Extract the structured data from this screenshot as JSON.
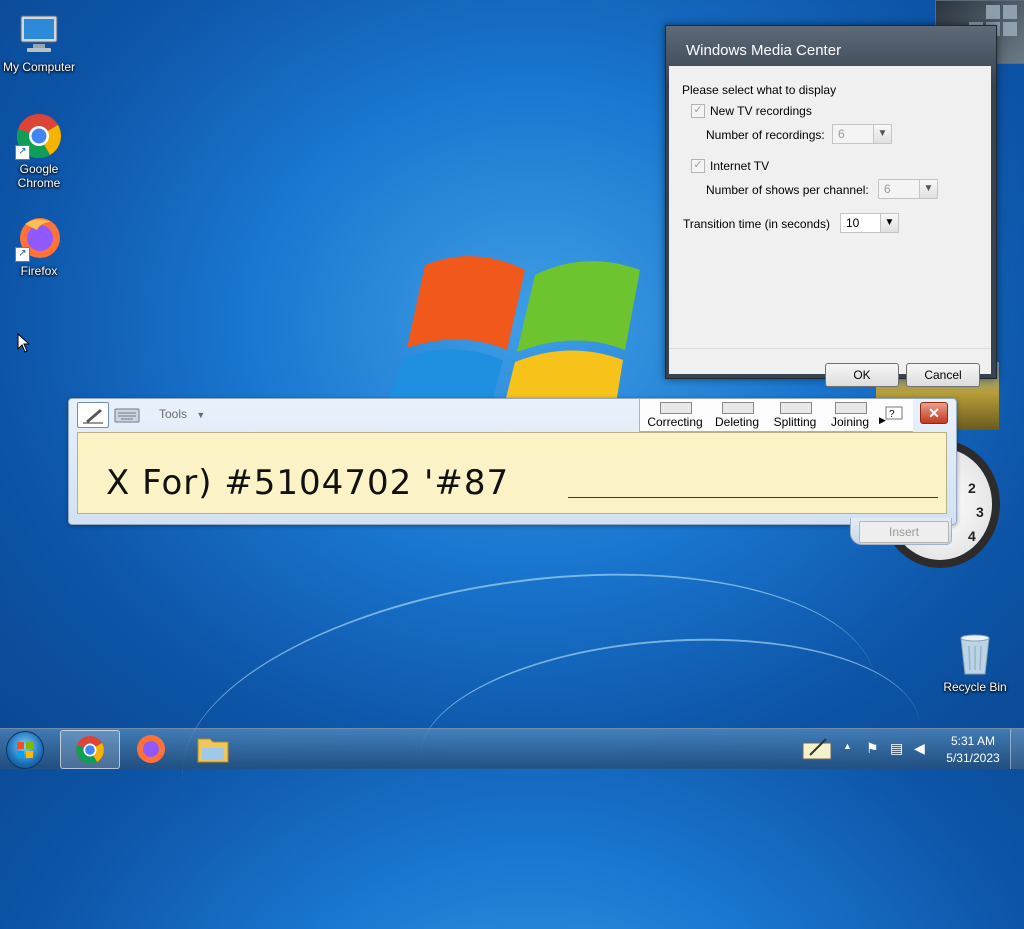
{
  "desktop": {
    "icons": [
      {
        "label": "My Computer"
      },
      {
        "label": "Google Chrome"
      },
      {
        "label": "Firefox"
      },
      {
        "label": "Recycle Bin"
      }
    ]
  },
  "wmc_dialog": {
    "title": "Windows Media Center",
    "prompt": "Please select what to display",
    "new_tv": {
      "label": "New TV recordings",
      "checked": true
    },
    "num_recordings": {
      "label": "Number of recordings:",
      "value": "6"
    },
    "internet_tv": {
      "label": "Internet TV",
      "checked": true
    },
    "shows_per_channel": {
      "label": "Number of shows per channel:",
      "value": "6"
    },
    "transition": {
      "label": "Transition time (in seconds)",
      "value": "10"
    },
    "ok_label": "OK",
    "cancel_label": "Cancel"
  },
  "input_panel": {
    "tools_label": "Tools",
    "commands": [
      "Correcting",
      "Deleting",
      "Splitting",
      "Joining"
    ],
    "ink_text": "X For) #5104702 '#87",
    "insert_label": "Insert"
  },
  "clock_gadget": {
    "numbers": [
      "2",
      "3",
      "4"
    ]
  },
  "taskbar": {
    "time": "5:31 AM",
    "date": "5/31/2023"
  },
  "colors": {
    "desktop_blue": "#1a76cf",
    "tip_writing_area": "#fbf3c6",
    "close_red": "#c4391f"
  }
}
